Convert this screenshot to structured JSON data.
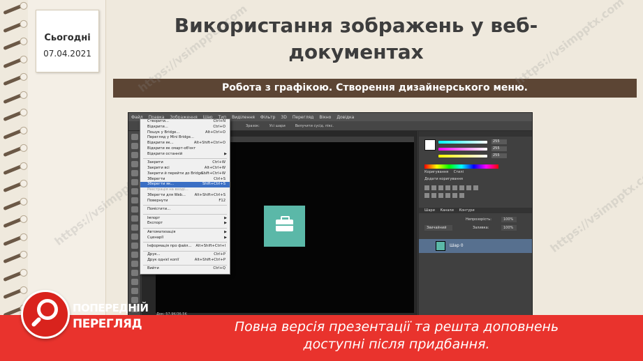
{
  "slide": {
    "date_label": "Сьогодні",
    "date_value": "07.04.2021",
    "title_line1": "Використання зображень у веб-",
    "title_line2": "документах",
    "subtitle": "Робота з графікою. Створення дизайнерського меню."
  },
  "watermark": {
    "text": "https://vsimpptx.com"
  },
  "app": {
    "menubar": [
      "Файл",
      "Правка",
      "Зображення",
      "Шар",
      "Тип",
      "Виділення",
      "Фільтр",
      "3D",
      "Перегляд",
      "Вікно",
      "Довідка"
    ],
    "status": "Док: 57,9K/36,5K",
    "options": [
      "Зразок:",
      "Усі шари",
      "Вилучити сусід. пікс."
    ],
    "layers_tabs": [
      "Шари",
      "Канали",
      "Контури"
    ],
    "layer_mode": "Звичайний",
    "layer_opacity_label": "Непрозорість:",
    "layer_opacity": "100%",
    "layer_fill_label": "Заливка:",
    "layer_fill": "100%",
    "layer_name": "Шар 0",
    "adjust_tab": "Коригування",
    "styles_tab": "Стилі",
    "adjust_title": "Додати коригування",
    "color_values": [
      "255",
      "255",
      "255"
    ]
  },
  "file_menu": {
    "items": [
      {
        "label": "Створити...",
        "shortcut": "Ctrl+N"
      },
      {
        "label": "Відкрити...",
        "shortcut": "Ctrl+O"
      },
      {
        "label": "Пошук у Bridge...",
        "shortcut": "Alt+Ctrl+O"
      },
      {
        "label": "Перегляд у Mini Bridge..."
      },
      {
        "label": "Відкрити як...",
        "shortcut": "Alt+Shift+Ctrl+O"
      },
      {
        "label": "Відкрити як смарт-об'єкт"
      },
      {
        "label": "Відкрити останній",
        "submenu": true
      },
      {
        "sep": true
      },
      {
        "label": "Закрити",
        "shortcut": "Ctrl+W"
      },
      {
        "label": "Закрити всі",
        "shortcut": "Alt+Ctrl+W"
      },
      {
        "label": "Закрити й перейти до Bridge...",
        "shortcut": "Shift+Ctrl+W"
      },
      {
        "label": "Зберегти",
        "shortcut": "Ctrl+S"
      },
      {
        "label": "Зберегти як...",
        "shortcut": "Shift+Ctrl+S",
        "highlighted": true
      },
      {
        "label": "Реєстрація на вході...",
        "disabled": true
      },
      {
        "label": "Зберегти для Web...",
        "shortcut": "Alt+Shift+Ctrl+S"
      },
      {
        "label": "Повернути",
        "shortcut": "F12"
      },
      {
        "sep": true
      },
      {
        "label": "Помістити..."
      },
      {
        "sep": true
      },
      {
        "label": "Імпорт",
        "submenu": true
      },
      {
        "label": "Експорт",
        "submenu": true
      },
      {
        "sep": true
      },
      {
        "label": "Автоматизація",
        "submenu": true
      },
      {
        "label": "Сценарії",
        "submenu": true
      },
      {
        "sep": true
      },
      {
        "label": "Інформація про файл...",
        "shortcut": "Alt+Shift+Ctrl+I"
      },
      {
        "sep": true
      },
      {
        "label": "Друк...",
        "shortcut": "Ctrl+P"
      },
      {
        "label": "Друк однієї копії",
        "shortcut": "Alt+Shift+Ctrl+P"
      },
      {
        "sep": true
      },
      {
        "label": "Вийти",
        "shortcut": "Ctrl+Q"
      }
    ]
  },
  "preview": {
    "badge_line1": "ПОПЕРЕДНІЙ",
    "badge_line2": "ПЕРЕГЛЯД",
    "message_line1": "Повна версія презентації та решта доповнень",
    "message_line2": "доступні після придбання."
  },
  "colors": {
    "accent_brown": "#5c4534",
    "preview_red": "#e9332d",
    "tile_teal": "#5bb8a8"
  }
}
